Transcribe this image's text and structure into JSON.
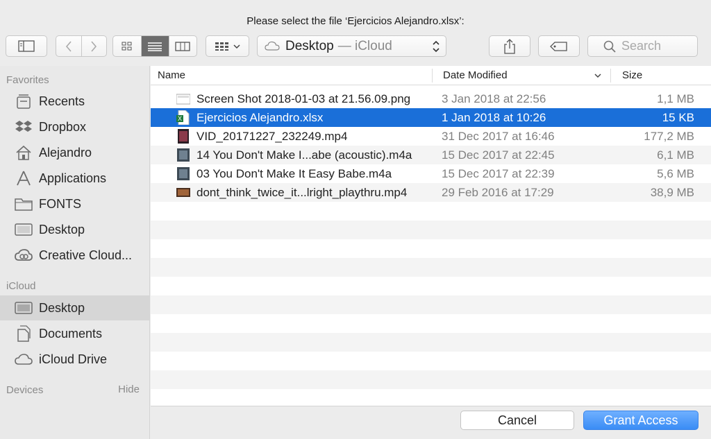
{
  "dialog": {
    "title": "Please select the file ‘Ejercicios Alejandro.xlsx’:"
  },
  "toolbar": {
    "location_name": "Desktop",
    "location_sub": "— iCloud",
    "search_placeholder": "Search",
    "view_mode": "list"
  },
  "sidebar": {
    "favorites_header": "Favorites",
    "favorites": [
      {
        "label": "Recents",
        "icon": "recents-icon"
      },
      {
        "label": "Dropbox",
        "icon": "dropbox-icon"
      },
      {
        "label": "Alejandro",
        "icon": "home-icon"
      },
      {
        "label": "Applications",
        "icon": "applications-icon"
      },
      {
        "label": "FONTS",
        "icon": "folder-icon"
      },
      {
        "label": "Desktop",
        "icon": "desktop-icon"
      },
      {
        "label": "Creative Cloud...",
        "icon": "creative-cloud-icon"
      }
    ],
    "icloud_header": "iCloud",
    "icloud": [
      {
        "label": "Desktop",
        "icon": "desktop-icon",
        "selected": true
      },
      {
        "label": "Documents",
        "icon": "documents-icon"
      },
      {
        "label": "iCloud Drive",
        "icon": "cloud-icon"
      }
    ],
    "devices_header": "Devices",
    "devices_hide": "Hide"
  },
  "file_list": {
    "columns": {
      "name": "Name",
      "date": "Date Modified",
      "size": "Size"
    },
    "rows": [
      {
        "name": "Screen Shot 2018-01-03 at 21.56.09.png",
        "date": "3 Jan 2018 at 22:56",
        "size": "1,1 MB",
        "icon": "png-file-icon"
      },
      {
        "name": "Ejercicios Alejandro.xlsx",
        "date": "1 Jan 2018 at 10:26",
        "size": "15 KB",
        "icon": "excel-file-icon",
        "selected": true
      },
      {
        "name": "VID_20171227_232249.mp4",
        "date": "31 Dec 2017 at 16:46",
        "size": "177,2 MB",
        "icon": "video-file-icon"
      },
      {
        "name": "14 You Don't Make I...abe (acoustic).m4a",
        "date": "15 Dec 2017 at 22:45",
        "size": "6,1 MB",
        "icon": "audio-file-icon"
      },
      {
        "name": "03 You Don't Make It Easy Babe.m4a",
        "date": "15 Dec 2017 at 22:39",
        "size": "5,6 MB",
        "icon": "audio-file-icon"
      },
      {
        "name": "dont_think_twice_it...lright_playthru.mp4",
        "date": "29 Feb 2016 at 17:29",
        "size": "38,9 MB",
        "icon": "video-file-icon"
      }
    ]
  },
  "footer": {
    "cancel_label": "Cancel",
    "grant_label": "Grant Access"
  },
  "colors": {
    "selection": "#1a6fd9",
    "primary_button": "#3a8cf5"
  }
}
